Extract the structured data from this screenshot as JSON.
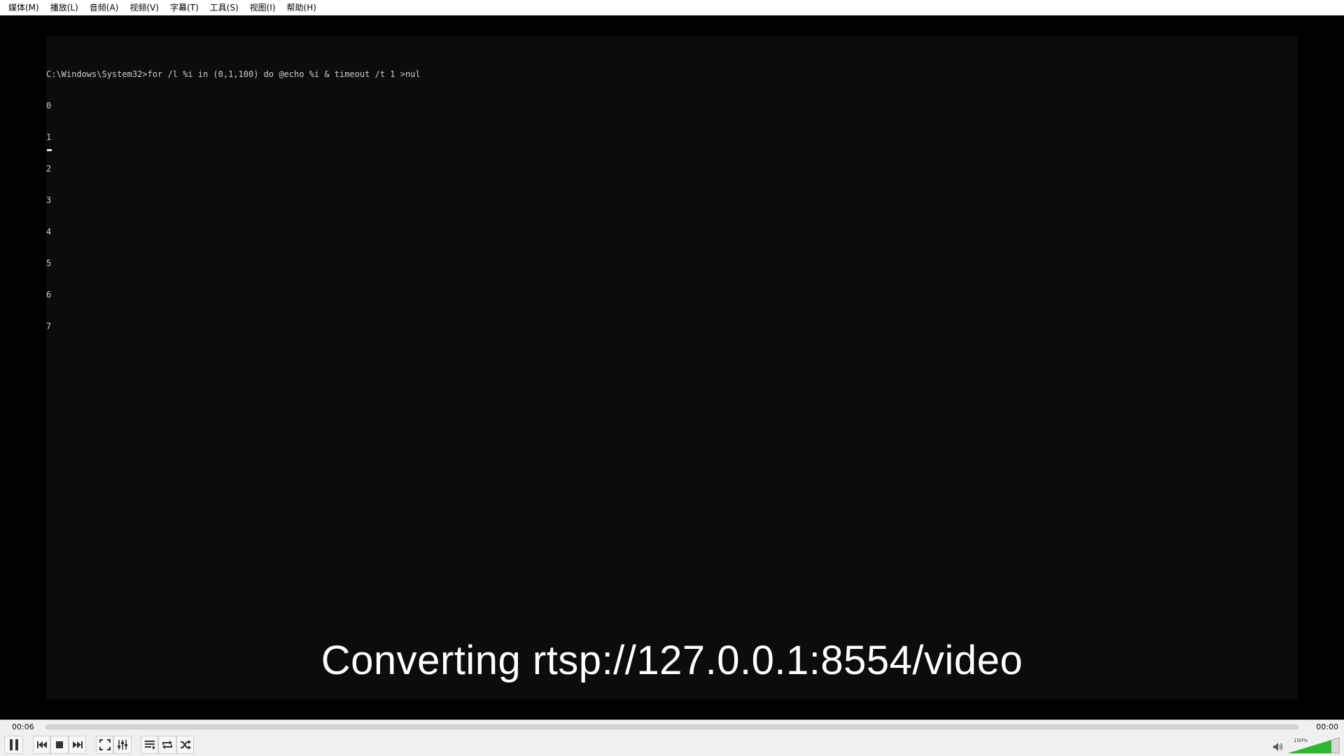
{
  "menu": {
    "items": [
      {
        "label": "媒体(M)"
      },
      {
        "label": "播放(L)"
      },
      {
        "label": "音频(A)"
      },
      {
        "label": "视频(V)"
      },
      {
        "label": "字幕(T)"
      },
      {
        "label": "工具(S)"
      },
      {
        "label": "视图(I)"
      },
      {
        "label": "帮助(H)"
      }
    ]
  },
  "video": {
    "terminal": {
      "command_line": "C:\\Windows\\System32>for /l %i in (0,1,100) do @echo %i & timeout /t 1 >nul",
      "output_lines": [
        "0",
        "1",
        "2",
        "3",
        "4",
        "5",
        "6",
        "7"
      ],
      "background_color": "#0c0c0c",
      "text_color": "#cccccc"
    },
    "subtitle": "Converting rtsp://127.0.0.1:8554/video"
  },
  "controls": {
    "time_elapsed": "00:06",
    "time_total": "00:00",
    "seek_progress": 0,
    "volume_label": "100%",
    "volume_level": 1.0,
    "volume_color": "#2fb52f",
    "buttons": {
      "pause": "pause-icon",
      "previous": "skip-previous-icon",
      "stop": "stop-icon",
      "next": "skip-next-icon",
      "fullscreen": "fullscreen-icon",
      "extended": "equalizer-icon",
      "playlist": "playlist-icon",
      "loop": "loop-icon",
      "random": "shuffle-icon"
    }
  }
}
